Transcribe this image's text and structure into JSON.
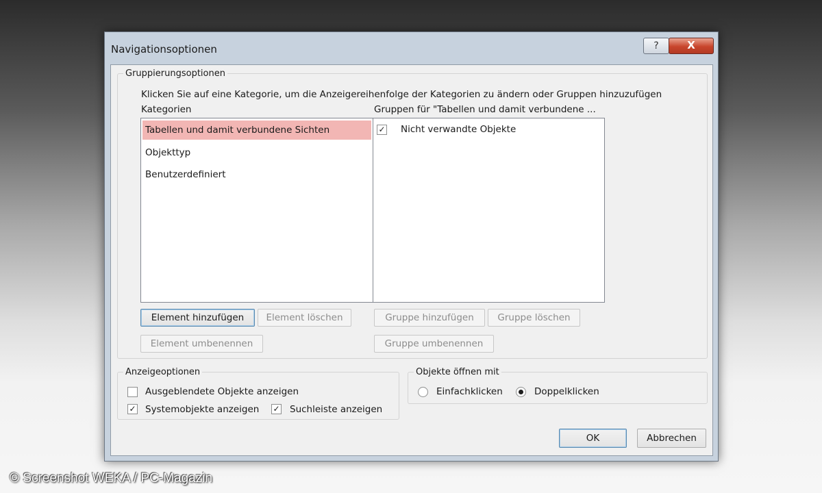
{
  "dialog": {
    "title": "Navigationsoptionen",
    "help_label": "?",
    "close_label": "X"
  },
  "grouping": {
    "legend": "Gruppierungsoptionen",
    "instruction": "Klicken Sie auf eine Kategorie, um die Anzeigereihenfolge der Kategorien zu ändern oder Gruppen hinzuzufügen",
    "categories_header": "Kategorien",
    "groups_header": "Gruppen für \"Tabellen und damit verbundene ...",
    "categories": [
      "Tabellen und damit verbundene Sichten",
      "Objekttyp",
      "Benutzerdefiniert"
    ],
    "selected_category_index": 0,
    "groups": [
      {
        "label": "Nicht verwandte Objekte",
        "checked": true
      }
    ],
    "buttons": {
      "add_element": "Element hinzufügen",
      "delete_element": "Element löschen",
      "rename_element": "Element umbenennen",
      "add_group": "Gruppe hinzufügen",
      "delete_group": "Gruppe löschen",
      "rename_group": "Gruppe umbenennen"
    }
  },
  "display": {
    "legend": "Anzeigeoptionen",
    "show_hidden": {
      "label": "Ausgeblendete Objekte anzeigen",
      "checked": false
    },
    "show_system": {
      "label": "Systemobjekte anzeigen",
      "checked": true
    },
    "show_search": {
      "label": "Suchleiste anzeigen",
      "checked": true
    }
  },
  "open_with": {
    "legend": "Objekte öffnen mit",
    "single_click": {
      "label": "Einfachklicken",
      "selected": false
    },
    "double_click": {
      "label": "Doppelklicken",
      "selected": true
    }
  },
  "footer": {
    "ok_label": "OK",
    "cancel_label": "Abbrechen"
  },
  "copyright": "© Screenshot WEKA / PC-Magazin",
  "colors": {
    "selection": "#f2b6b4",
    "close_button": "#c8452c",
    "frame": "#c7d2de"
  }
}
